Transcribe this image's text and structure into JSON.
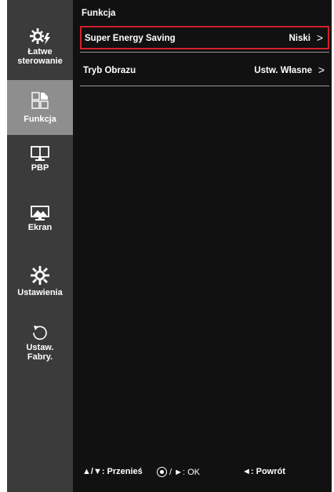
{
  "sidebar": {
    "items": [
      {
        "label_line1": "Łatwe",
        "label_line2": "sterowanie",
        "icon": "gear-bolt-icon",
        "active": false
      },
      {
        "label_line1": "Funkcja",
        "icon": "grid-icon",
        "active": true
      },
      {
        "label_line1": "PBP",
        "icon": "monitor-split-icon",
        "active": false
      },
      {
        "label_line1": "Ekran",
        "icon": "picture-icon",
        "active": false
      },
      {
        "label_line1": "Ustawienia",
        "icon": "gear-icon",
        "active": false
      },
      {
        "label_line1": "Ustaw.",
        "label_line2": "Fabry.",
        "icon": "reset-icon",
        "active": false
      }
    ]
  },
  "main": {
    "header": "Funkcja",
    "rows": [
      {
        "label": "Super Energy Saving",
        "value": "Niski",
        "chevron": ">",
        "selected": true
      },
      {
        "label": "Tryb Obrazu",
        "value": "Ustw. Własne",
        "chevron": ">",
        "selected": false
      }
    ]
  },
  "footer": {
    "nav": "▲/▼: Przenieś",
    "ok": "/ ►: OK",
    "back": "◄: Powrót"
  },
  "colors": {
    "sidebar_bg": "#3b3b3b",
    "sidebar_active_bg": "#8e8e8e",
    "main_bg": "#111111",
    "selection_border": "#d0202a"
  }
}
